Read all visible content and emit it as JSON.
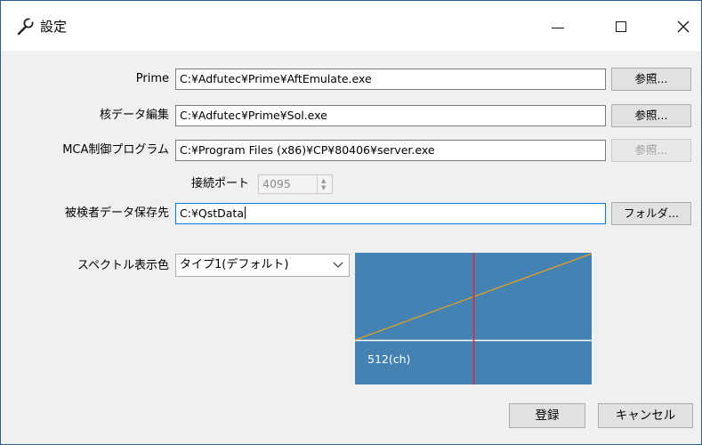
{
  "window": {
    "title": "設定",
    "controls": {
      "minimize": "minimize",
      "maximize": "maximize",
      "close": "close"
    }
  },
  "form": {
    "prime": {
      "label": "Prime",
      "path": "C:¥Adfutec¥Prime¥AftEmulate.exe",
      "browse": "参照..."
    },
    "nuclide": {
      "label": "核データ編集",
      "path": "C:¥Adfutec¥Prime¥Sol.exe",
      "browse": "参照..."
    },
    "mca": {
      "label": "MCA制御プログラム",
      "path": "C:¥Program Files (x86)¥CP¥80406¥server.exe",
      "browse": "参照..."
    },
    "port": {
      "label": "接続ポート",
      "value": "4095"
    },
    "subject_data": {
      "label": "被検者データ保存先",
      "path": "C:¥QstData",
      "browse": "フォルダ..."
    },
    "spectrum_color": {
      "label": "スペクトル表示色",
      "selected": "タイプ1(デフォルト)"
    }
  },
  "preview": {
    "background_color": "#4582b4",
    "curve_color": "#e8a317",
    "marker_color": "#e8202a",
    "baseline_color": "#ffffff",
    "marker_label": "512(ch)"
  },
  "actions": {
    "register": "登録",
    "cancel": "キャンセル"
  },
  "icons": {
    "title": "wrench-icon",
    "combo": "chevron-down-icon"
  }
}
